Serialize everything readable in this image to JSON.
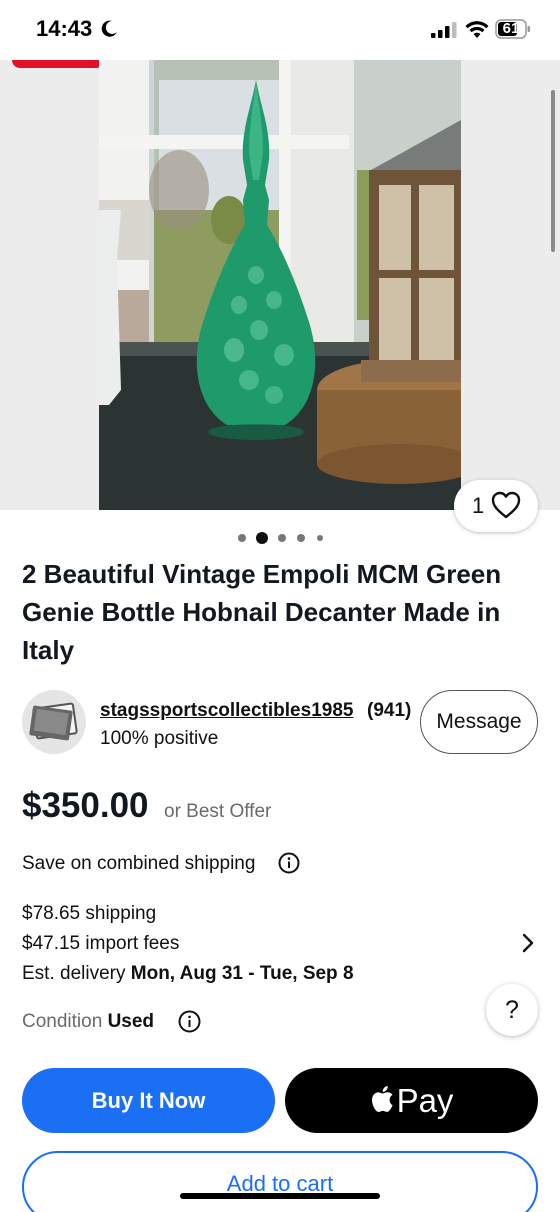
{
  "status_bar": {
    "time": "14:43",
    "battery_level": "61",
    "icons": [
      "moon-icon",
      "signal-icon",
      "wifi-icon",
      "battery-icon"
    ]
  },
  "gallery": {
    "watch_count": "1",
    "current_photo_index": 2,
    "photo_count": 5
  },
  "listing": {
    "title": "2 Beautiful Vintage Empoli MCM Green Genie Bottle Hobnail Decanter Made in Italy",
    "seller": {
      "name": "stagssportscollectibles1985",
      "feedback_count": "(941)",
      "rating": "100% positive",
      "message_label": "Message"
    },
    "price": "$350.00",
    "offer_text": "or Best Offer",
    "combined_shipping": "Save on combined shipping",
    "shipping": "$78.65 shipping",
    "import_fees": "$47.15 import fees",
    "delivery_prefix": "Est. delivery",
    "delivery_dates": "Mon, Aug 31 - Tue, Sep 8",
    "condition_label": "Condition",
    "condition_value": "Used"
  },
  "actions": {
    "help_label": "?",
    "buy_now_label": "Buy It Now",
    "apple_pay_label": "Pay",
    "add_to_cart_label": "Add to cart"
  },
  "colors": {
    "accent_blue": "#1a6ff5",
    "ribbon_red": "#e0112a",
    "glass_green": "#1f9a6a"
  }
}
